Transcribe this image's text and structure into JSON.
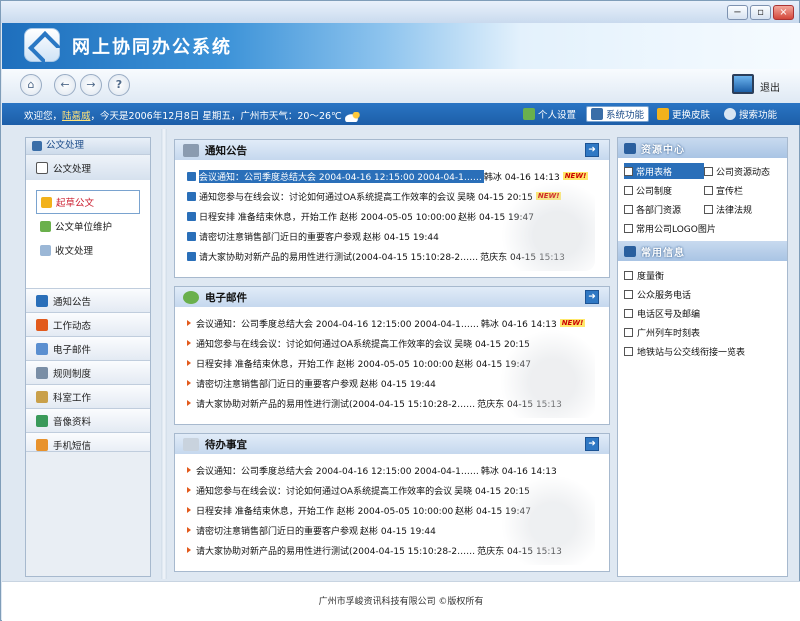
{
  "window": {
    "controls": {
      "minimize": "−",
      "maximize": "▫",
      "close": "×"
    }
  },
  "header": {
    "app_title": "网上协同办公系统"
  },
  "toolbar": {
    "home_icon": "⌂",
    "back_icon": "←",
    "forward_icon": "→",
    "help_icon": "?",
    "exit_label": "退出"
  },
  "infobar": {
    "greeting_prefix": "欢迎您，",
    "user": "陆嘉威",
    "greeting_suffix": "，今天是2006年12月8日 星期五，广州市天气：20～26℃",
    "buttons": [
      {
        "label": "个人设置"
      },
      {
        "label": "系统功能"
      },
      {
        "label": "更换皮肤"
      },
      {
        "label": "搜索功能"
      }
    ]
  },
  "sidebar": {
    "header": "公文处理",
    "open_category": "公文处理",
    "subitems": [
      {
        "label": "起草公文"
      },
      {
        "label": "公文单位维护"
      },
      {
        "label": "收文处理"
      }
    ],
    "categories": [
      {
        "label": "通知公告"
      },
      {
        "label": "工作动态"
      },
      {
        "label": "电子邮件"
      },
      {
        "label": "规则制度"
      },
      {
        "label": "科室工作"
      },
      {
        "label": "音像资料"
      },
      {
        "label": "手机短信"
      }
    ]
  },
  "cards": [
    {
      "title": "通知公告",
      "rows": [
        {
          "text": "会议通知：公司季度总结大会 2004-04-16 12:15:00 2004-04-1……",
          "meta": " 韩冰 04-16 14:13",
          "new": "NEW!"
        },
        {
          "text": "通知您参与在线会议：讨论如何通过OA系统提高工作效率的会议",
          "meta": " 吴晓 04-15 20:15",
          "new": "NEW!"
        },
        {
          "text": "日程安排 准备结束休息，开始工作 赵彬 2004-05-05 10:00:00",
          "meta": " 赵彬 04-15 19:47",
          "new": ""
        },
        {
          "text": "请密切注意销售部门近日的重要客户参观",
          "meta": " 赵彬 04-15 19:44",
          "new": ""
        },
        {
          "text": "请大家协助对新产品的易用性进行测试(2004-04-15 15:10:28-2……",
          "meta": " 范庆东 04-15 15:13",
          "new": ""
        }
      ]
    },
    {
      "title": "电子邮件",
      "rows": [
        {
          "text": "会议通知：公司季度总结大会 2004-04-16 12:15:00 2004-04-1……",
          "meta": " 韩冰 04-16 14:13",
          "new": "NEW!"
        },
        {
          "text": "通知您参与在线会议：讨论如何通过OA系统提高工作效率的会议",
          "meta": " 吴晓 04-15 20:15",
          "new": ""
        },
        {
          "text": "日程安排 准备结束休息，开始工作 赵彬 2004-05-05 10:00:00",
          "meta": " 赵彬 04-15 19:47",
          "new": ""
        },
        {
          "text": "请密切注意销售部门近日的重要客户参观",
          "meta": " 赵彬 04-15 19:44",
          "new": ""
        },
        {
          "text": "请大家协助对新产品的易用性进行测试(2004-04-15 15:10:28-2……",
          "meta": " 范庆东 04-15 15:13",
          "new": ""
        }
      ]
    },
    {
      "title": "待办事宜",
      "rows": [
        {
          "text": "会议通知：公司季度总结大会 2004-04-16 12:15:00 2004-04-1……",
          "meta": " 韩冰 04-16 14:13",
          "new": ""
        },
        {
          "text": "通知您参与在线会议：讨论如何通过OA系统提高工作效率的会议",
          "meta": " 吴晓 04-15 20:15",
          "new": ""
        },
        {
          "text": "日程安排 准备结束休息，开始工作 赵彬 2004-05-05 10:00:00",
          "meta": " 赵彬 04-15 19:47",
          "new": ""
        },
        {
          "text": "请密切注意销售部门近日的重要客户参观",
          "meta": " 赵彬 04-15 19:44",
          "new": ""
        },
        {
          "text": "请大家协助对新产品的易用性进行测试(2004-04-15 15:10:28-2……",
          "meta": " 范庆东 04-15 15:13",
          "new": ""
        }
      ]
    }
  ],
  "more_icon": "➜",
  "rightpanel": {
    "resources_title": "资源中心",
    "resources": [
      {
        "label": "常用表格"
      },
      {
        "label": "公司资源动态"
      },
      {
        "label": "公司制度"
      },
      {
        "label": "宣传栏"
      },
      {
        "label": "各部门资源"
      },
      {
        "label": "法律法规"
      },
      {
        "label": "常用公司LOGO图片"
      },
      {
        "label": ""
      }
    ],
    "info_title": "常用信息",
    "info": [
      {
        "label": "度量衡"
      },
      {
        "label": "公众服务电话"
      },
      {
        "label": "电话区号及邮编"
      },
      {
        "label": "广州列车时刻表"
      },
      {
        "label": "地铁站与公交线衔接一览表"
      }
    ]
  },
  "footer": {
    "copyright": "广州市孚峻资讯科技有限公司 ©版权所有"
  },
  "colors": {
    "accent": "#2a6fb9",
    "arrow": "#e25a1c",
    "highlight_user": "#ffe37a"
  }
}
